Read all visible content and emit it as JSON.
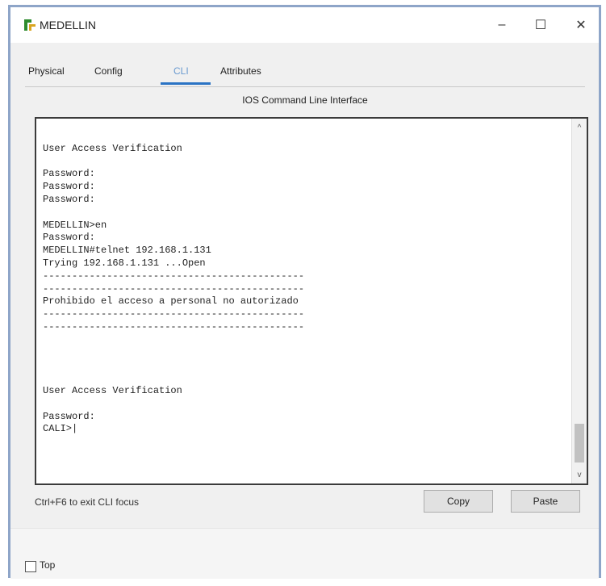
{
  "window": {
    "title": "MEDELLIN",
    "controls": {
      "minimize": "–",
      "maximize": "☐",
      "close": "✕"
    }
  },
  "tabs": [
    {
      "label": "Physical",
      "active": false
    },
    {
      "label": "Config",
      "active": false
    },
    {
      "label": "CLI",
      "active": true
    },
    {
      "label": "Attributes",
      "active": false
    }
  ],
  "cli": {
    "header": "IOS Command Line Interface",
    "lines": [
      "",
      "User Access Verification",
      "",
      "Password:",
      "Password:",
      "Password:",
      "",
      "MEDELLIN>en",
      "Password:",
      "MEDELLIN#telnet 192.168.1.131",
      "Trying 192.168.1.131 ...Open",
      "---------------------------------------------",
      "---------------------------------------------",
      "Prohibido el acceso a personal no autorizado",
      "---------------------------------------------",
      "---------------------------------------------",
      "",
      "",
      "",
      "",
      "User Access Verification",
      "",
      "Password:",
      "CALI>|"
    ]
  },
  "footer": {
    "hint": "Ctrl+F6 to exit CLI focus",
    "copy_label": "Copy",
    "paste_label": "Paste"
  },
  "bottom": {
    "top_label": "Top",
    "top_checked": false
  },
  "colors": {
    "window_border": "#8ea5c8",
    "active_tab_underline": "#2a73c4",
    "app_icon_green": "#2e8b2e"
  }
}
